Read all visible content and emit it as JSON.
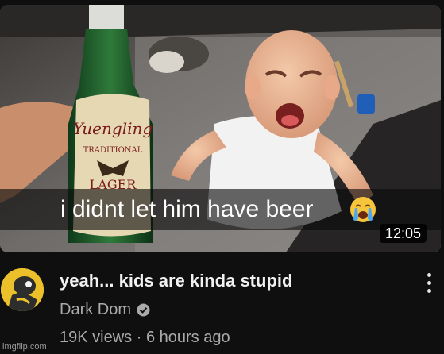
{
  "thumbnail": {
    "caption": "i didnt let him have beer",
    "emoji": "crying-face-icon",
    "duration": "12:05",
    "bottle_label": "Yuengling",
    "bottle_sublabel": "TRADITIONAL",
    "bottle_lager": "LAGER"
  },
  "video": {
    "title": "yeah... kids are kinda stupid",
    "channel": "Dark Dom",
    "views": "19K views",
    "separator": "·",
    "age": "6 hours ago"
  },
  "watermark": "imgflip.com",
  "colors": {
    "background": "#0f0f0f",
    "title": "#f1f1f1",
    "secondary_text": "#aaaaaa",
    "avatar_bg": "#ebc02a"
  }
}
